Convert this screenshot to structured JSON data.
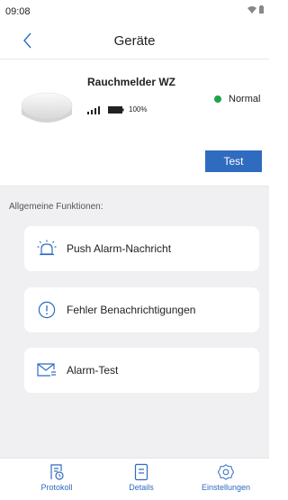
{
  "statusbar": {
    "time": "09:08"
  },
  "header": {
    "title": "Geräte"
  },
  "device": {
    "name": "Rauchmelder WZ",
    "status": "Normal",
    "status_color": "#1ea44a",
    "battery": "100%",
    "test_label": "Test"
  },
  "section": {
    "label": "Allgemeine Funktionen:"
  },
  "cards": [
    {
      "label": "Push Alarm-Nachricht",
      "icon": "alarm-bell-icon"
    },
    {
      "label": "Fehler Benachrichtigungen",
      "icon": "exclamation-circle-icon"
    },
    {
      "label": "Alarm-Test",
      "icon": "envelope-icon"
    }
  ],
  "tabs": [
    {
      "label": "Protokoll",
      "icon": "log-icon"
    },
    {
      "label": "Details",
      "icon": "document-icon"
    },
    {
      "label": "Einstellungen",
      "icon": "gear-icon"
    }
  ],
  "accent": "#2f6bbf"
}
